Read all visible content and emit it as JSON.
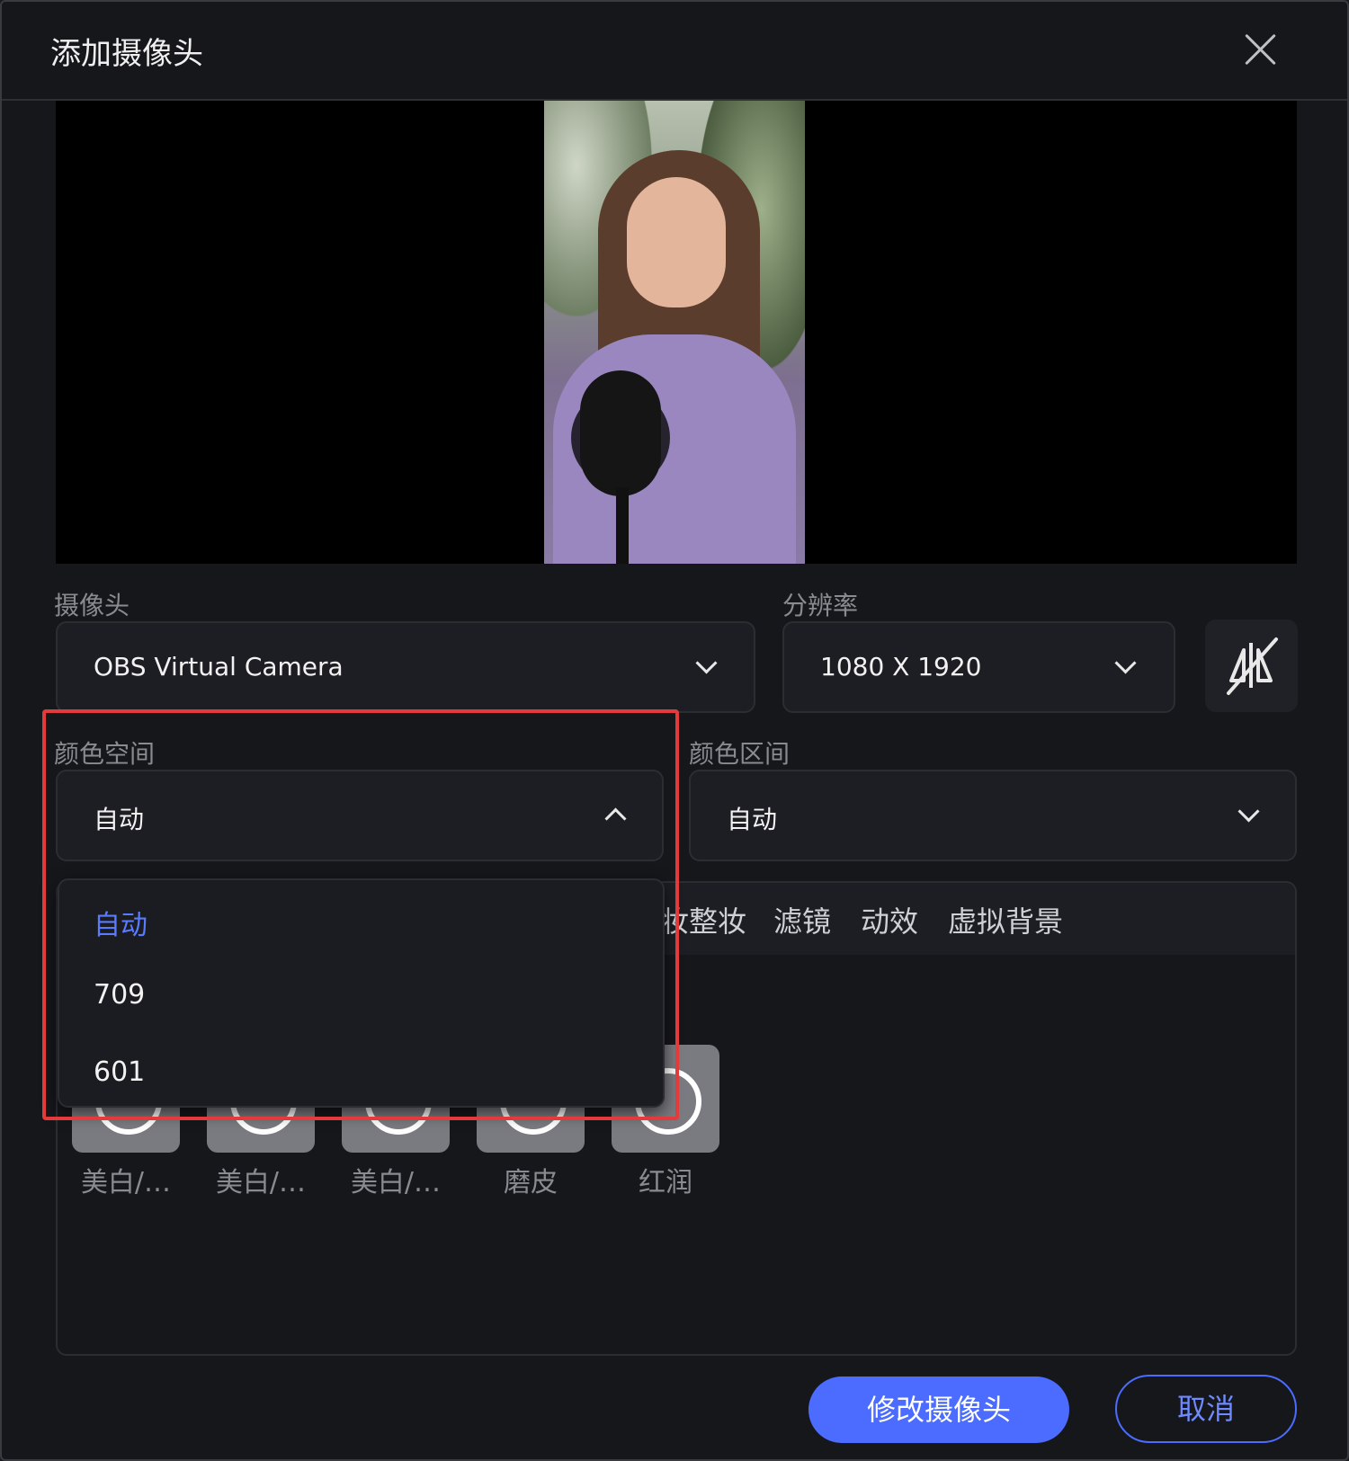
{
  "dialog": {
    "title": "添加摄像头"
  },
  "camera": {
    "label": "摄像头",
    "value": "OBS Virtual Camera"
  },
  "resolution": {
    "label": "分辨率",
    "value": "1080 X 1920"
  },
  "color_space": {
    "label": "颜色空间",
    "value": "自动",
    "options": [
      "自动",
      "709",
      "601"
    ],
    "selected_index": 0
  },
  "color_range": {
    "label": "颜色区间",
    "value": "自动"
  },
  "effects": {
    "tabs": [
      "妆整妆",
      "滤镜",
      "动效",
      "虚拟背景"
    ],
    "items": [
      {
        "label": "美白/…"
      },
      {
        "label": "美白/…"
      },
      {
        "label": "美白/…"
      },
      {
        "label": "磨皮"
      },
      {
        "label": "红润"
      }
    ]
  },
  "buttons": {
    "confirm": "修改摄像头",
    "cancel": "取消"
  },
  "colors": {
    "accent": "#4b6cff",
    "highlight": "#e33b3b",
    "background": "#16171b"
  },
  "icons": {
    "close": "close-icon",
    "mirror": "mirror-flip-icon",
    "dropdown": "chevron-down-icon"
  }
}
